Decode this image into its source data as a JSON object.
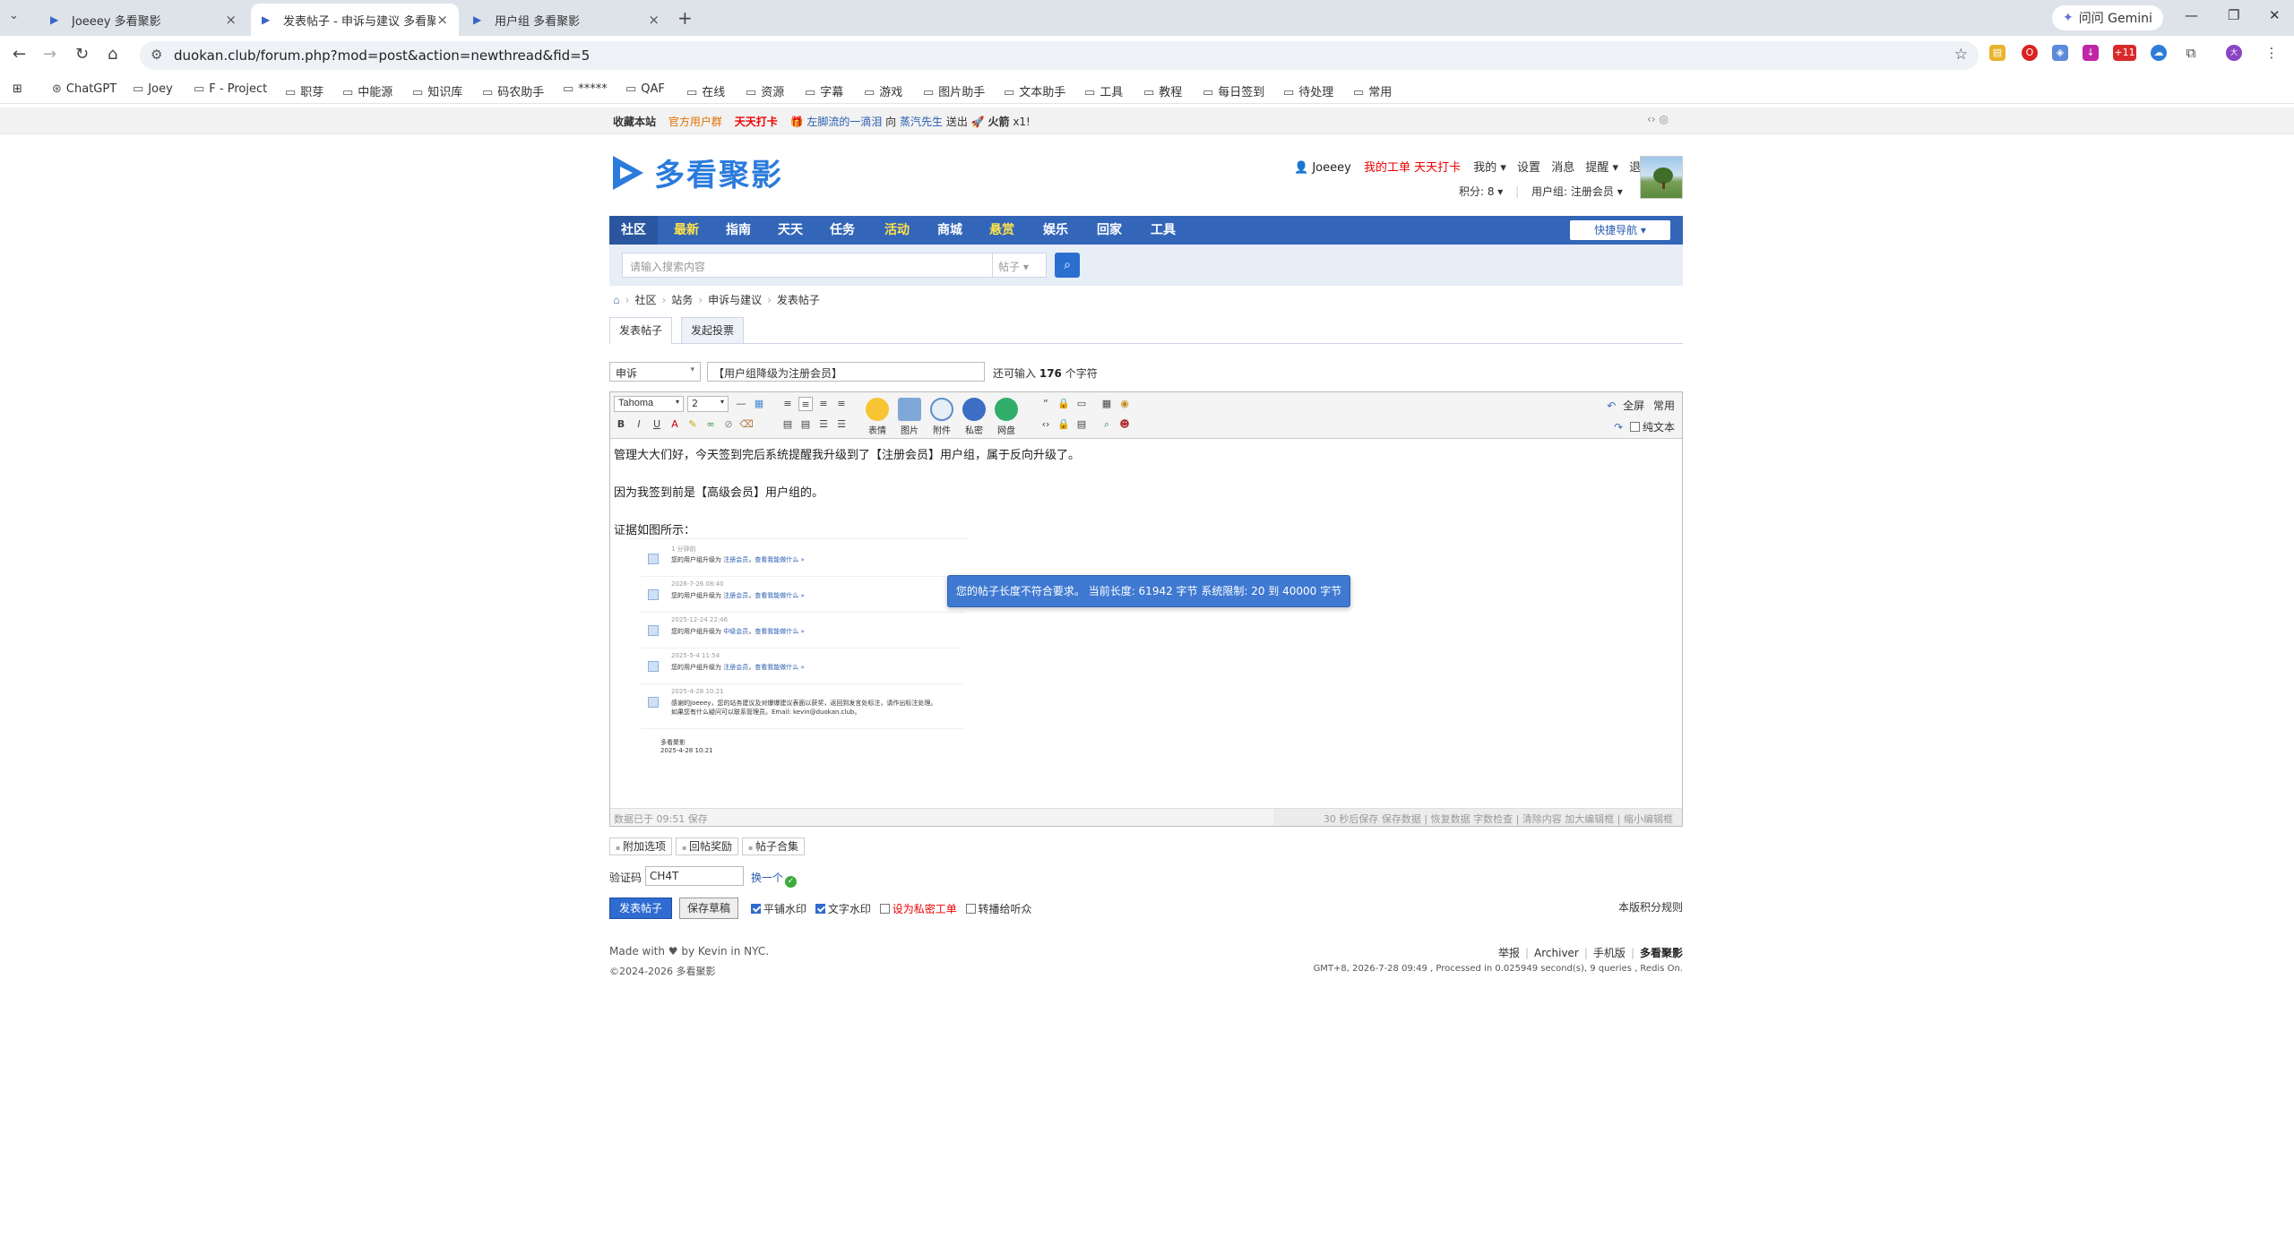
{
  "browser": {
    "tabs": [
      {
        "label": "Joeeey 多看聚影",
        "active": false
      },
      {
        "label": "发表帖子 - 申诉与建议 多看聚影",
        "active": true
      },
      {
        "label": "用户组 多看聚影",
        "active": false
      }
    ],
    "gemini_label": "问问 Gemini",
    "url": "duokan.club/forum.php?mod=post&action=newthread&fid=5",
    "bookmarks": [
      "ChatGPT",
      "Joey",
      "F - Project",
      "职芽",
      "中能源",
      "知识库",
      "码农助手",
      "*****",
      "QAF",
      "在线",
      "资源",
      "字幕",
      "游戏",
      "图片助手",
      "文本助手",
      "工具",
      "教程",
      "每日签到",
      "待处理",
      "常用"
    ]
  },
  "topbar": {
    "fav_site": "收藏本站",
    "official_group": "官方用户群",
    "checkin": "天天打卡",
    "msg_user": "左脚流的一滴泪",
    "msg_mid": "向",
    "msg_target": "蒸汽先生",
    "msg_action": "送出",
    "msg_item": "火箭",
    "msg_count": "x1!"
  },
  "header": {
    "logo_text": "多看聚影",
    "username": "Joeeey",
    "my_work": "我的工单 天天打卡",
    "links": [
      "我的 ▾",
      "设置",
      "消息",
      "提醒 ▾",
      "退出"
    ],
    "points": "积分: 8 ▾",
    "usergroup": "用户组: 注册会员 ▾"
  },
  "nav": {
    "items": [
      "社区",
      "最新",
      "指南",
      "天天",
      "任务",
      "活动",
      "商城",
      "悬赏",
      "娱乐",
      "回家",
      "工具"
    ],
    "quick_nav": "快捷导航 ▾",
    "search_placeholder": "请输入搜索内容",
    "search_type": "帖子 ▾"
  },
  "breadcrumb": [
    "社区",
    "站务",
    "申诉与建议",
    "发表帖子"
  ],
  "post_tabs": [
    "发表帖子",
    "发起投票"
  ],
  "form": {
    "thread_type": "申诉",
    "subject": "【用户组降级为注册会员】",
    "remaining_prefix": "还可输入",
    "remaining_count": "176",
    "remaining_suffix": "个字符"
  },
  "editor": {
    "font": "Tahoma",
    "size": "2",
    "big_buttons": [
      "表情",
      "图片",
      "附件",
      "私密",
      "网盘"
    ],
    "fullscreen": "全屏",
    "common": "常用",
    "plain_text": "纯文本",
    "body_lines": [
      "管理大大们好，今天签到完后系统提醒我升级到了【注册会员】用户组，属于反向升级了。",
      "因为我签到前是【高级会员】用户组的。",
      "证据如图所示："
    ],
    "evidence": [
      {
        "date": "1 分钟前",
        "pre": "您的用户组升级为",
        "group": "注册会员",
        "link": "查看我能做什么 »"
      },
      {
        "date": "2026-7-26 08:40",
        "pre": "您的用户组升级为",
        "group": "注册会员",
        "link": "查看我能做什么 »"
      },
      {
        "date": "2025-12-24 22:46",
        "pre": "您的用户组升级为",
        "group": "中级会员",
        "link": "查看我能做什么 »"
      },
      {
        "date": "2025-5-4 11:54",
        "pre": "您的用户组升级为",
        "group": "注册会员",
        "link": "查看我能做什么 »"
      },
      {
        "date": "2025-4-28 10:21",
        "pre": "感谢的Joeeey，您的站务建议及对爆爆建议表面以获奖，返回到发言处标注，请作出标注处理。",
        "group": "",
        "link": "如果您有什么疑问可以联系管理员。Email: kevin@duokan.club。"
      }
    ],
    "signature_name": "多看聚影",
    "signature_date": "2025-4-28 10:21",
    "alert": "您的帖子长度不符合要求。 当前长度: 61942 字节 系统限制: 20 到 40000 字节",
    "autosave": "数据已于 09:51 保存",
    "status_right": "30 秒后保存 保存数据 | 恢复数据    字数检查 | 清除内容    加大编辑框 | 缩小编辑框"
  },
  "options": [
    "附加选项",
    "回帖奖励",
    "帖子合集"
  ],
  "captcha": {
    "label": "验证码",
    "value": "CH4T",
    "change": "换一个"
  },
  "actions": {
    "submit": "发表帖子",
    "draft": "保存草稿",
    "checks": [
      {
        "label": "平铺水印",
        "checked": true,
        "red": false
      },
      {
        "label": "文字水印",
        "checked": true,
        "red": false
      },
      {
        "label": "设为私密工单",
        "checked": false,
        "red": true
      },
      {
        "label": "转播给听众",
        "checked": false,
        "red": false
      }
    ],
    "rules": "本版积分规则"
  },
  "footer": {
    "made_with": "Made with ♥ by Kevin in NYC.",
    "copyright": "©2024-2026 多看聚影",
    "links": [
      "举报",
      "Archiver",
      "手机版"
    ],
    "brand": "多看聚影",
    "stats": "GMT+8, 2026-7-28 09:49 , Processed in 0.025949 second(s), 9 queries , Redis On."
  },
  "colors": {
    "nav_blue": "#3366b8",
    "accent_red": "#ee0000",
    "alert_blue": "#3f79d1",
    "link_blue": "#2a5db0"
  }
}
